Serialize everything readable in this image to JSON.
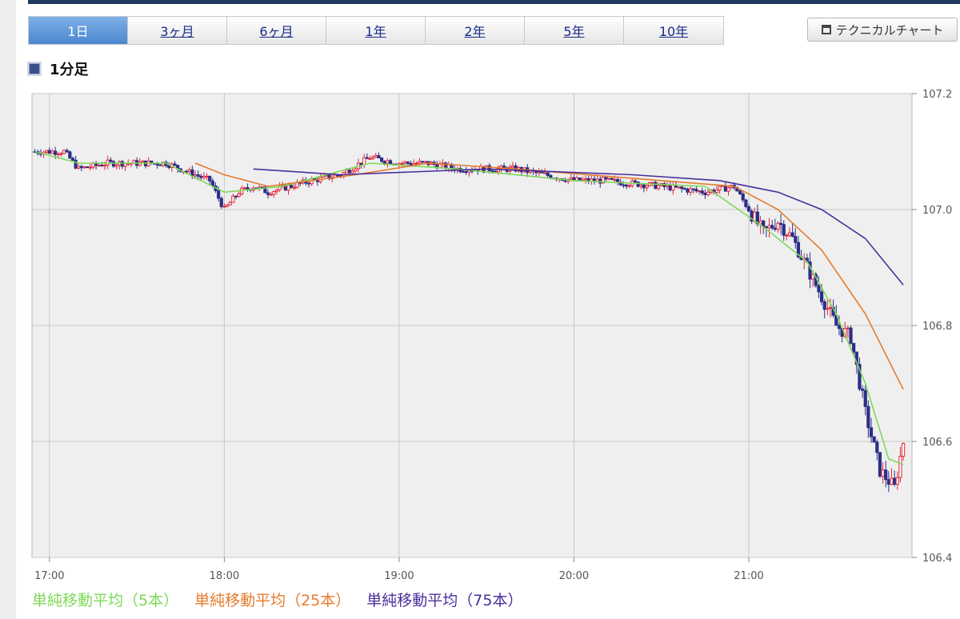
{
  "tabs": [
    {
      "label": "1日",
      "active": true
    },
    {
      "label": "3ヶ月",
      "active": false
    },
    {
      "label": "6ヶ月",
      "active": false
    },
    {
      "label": "1年",
      "active": false
    },
    {
      "label": "2年",
      "active": false
    },
    {
      "label": "5年",
      "active": false
    },
    {
      "label": "10年",
      "active": false
    }
  ],
  "tech_button": {
    "label": "テクニカルチャート",
    "icon": "window-icon"
  },
  "heading": {
    "label": "1分足"
  },
  "legend": [
    {
      "label": "単純移動平均（5本）",
      "color": "#7ed957"
    },
    {
      "label": "単純移動平均（25本）",
      "color": "#e57b2e"
    },
    {
      "label": "単純移動平均（75本）",
      "color": "#4a2e9b"
    }
  ],
  "chart_data": {
    "type": "candlestick",
    "interval": "1分足",
    "x_start": "16:54",
    "x_end": "21:56",
    "xticks": [
      "17:00",
      "18:00",
      "19:00",
      "20:00",
      "21:00"
    ],
    "yticks": [
      "106.4",
      "106.6",
      "106.8",
      "107.0",
      "107.2"
    ],
    "ylim": [
      106.4,
      107.2
    ],
    "colors": {
      "up": "#e0283c",
      "down": "#2b2f86",
      "grid": "#c8c8c8",
      "plot_bg": "#efefef"
    },
    "price_path": [
      [
        "16:55",
        107.1
      ],
      [
        "17:05",
        107.1
      ],
      [
        "17:10",
        107.07
      ],
      [
        "17:20",
        107.08
      ],
      [
        "17:40",
        107.08
      ],
      [
        "17:50",
        107.06
      ],
      [
        "17:55",
        107.05
      ],
      [
        "18:00",
        107.0
      ],
      [
        "18:05",
        107.03
      ],
      [
        "18:10",
        107.04
      ],
      [
        "18:15",
        107.03
      ],
      [
        "18:30",
        107.05
      ],
      [
        "18:40",
        107.06
      ],
      [
        "18:50",
        107.09
      ],
      [
        "19:00",
        107.08
      ],
      [
        "19:10",
        107.08
      ],
      [
        "19:20",
        107.07
      ],
      [
        "19:40",
        107.07
      ],
      [
        "20:00",
        107.05
      ],
      [
        "20:10",
        107.05
      ],
      [
        "20:30",
        107.04
      ],
      [
        "20:45",
        107.03
      ],
      [
        "20:55",
        107.04
      ],
      [
        "21:00",
        107.0
      ],
      [
        "21:05",
        106.96
      ],
      [
        "21:10",
        106.98
      ],
      [
        "21:15",
        106.95
      ],
      [
        "21:20",
        106.9
      ],
      [
        "21:25",
        106.85
      ],
      [
        "21:30",
        106.8
      ],
      [
        "21:35",
        106.78
      ],
      [
        "21:40",
        106.65
      ],
      [
        "21:45",
        106.55
      ],
      [
        "21:50",
        106.52
      ],
      [
        "21:53",
        106.6
      ]
    ],
    "series": [
      {
        "name": "単純移動平均（5本）",
        "color": "#7ed957",
        "points": [
          [
            "16:55",
            107.1
          ],
          [
            "17:10",
            107.08
          ],
          [
            "17:40",
            107.08
          ],
          [
            "18:00",
            107.03
          ],
          [
            "18:20",
            107.04
          ],
          [
            "18:50",
            107.08
          ],
          [
            "19:20",
            107.07
          ],
          [
            "20:00",
            107.05
          ],
          [
            "20:45",
            107.04
          ],
          [
            "21:05",
            106.97
          ],
          [
            "21:20",
            106.91
          ],
          [
            "21:30",
            106.82
          ],
          [
            "21:40",
            106.7
          ],
          [
            "21:48",
            106.57
          ],
          [
            "21:53",
            106.56
          ]
        ]
      },
      {
        "name": "単純移動平均（25本）",
        "color": "#e57b2e",
        "points": [
          [
            "17:50",
            107.08
          ],
          [
            "18:00",
            107.06
          ],
          [
            "18:15",
            107.04
          ],
          [
            "18:45",
            107.06
          ],
          [
            "19:10",
            107.08
          ],
          [
            "19:40",
            107.07
          ],
          [
            "20:30",
            107.05
          ],
          [
            "20:55",
            107.04
          ],
          [
            "21:10",
            107.0
          ],
          [
            "21:25",
            106.93
          ],
          [
            "21:40",
            106.82
          ],
          [
            "21:53",
            106.69
          ]
        ]
      },
      {
        "name": "単純移動平均（75本）",
        "color": "#4a2e9b",
        "points": [
          [
            "18:10",
            107.07
          ],
          [
            "18:40",
            107.06
          ],
          [
            "19:30",
            107.07
          ],
          [
            "20:20",
            107.06
          ],
          [
            "20:50",
            107.05
          ],
          [
            "21:10",
            107.03
          ],
          [
            "21:25",
            107.0
          ],
          [
            "21:40",
            106.95
          ],
          [
            "21:53",
            106.87
          ]
        ]
      }
    ]
  }
}
